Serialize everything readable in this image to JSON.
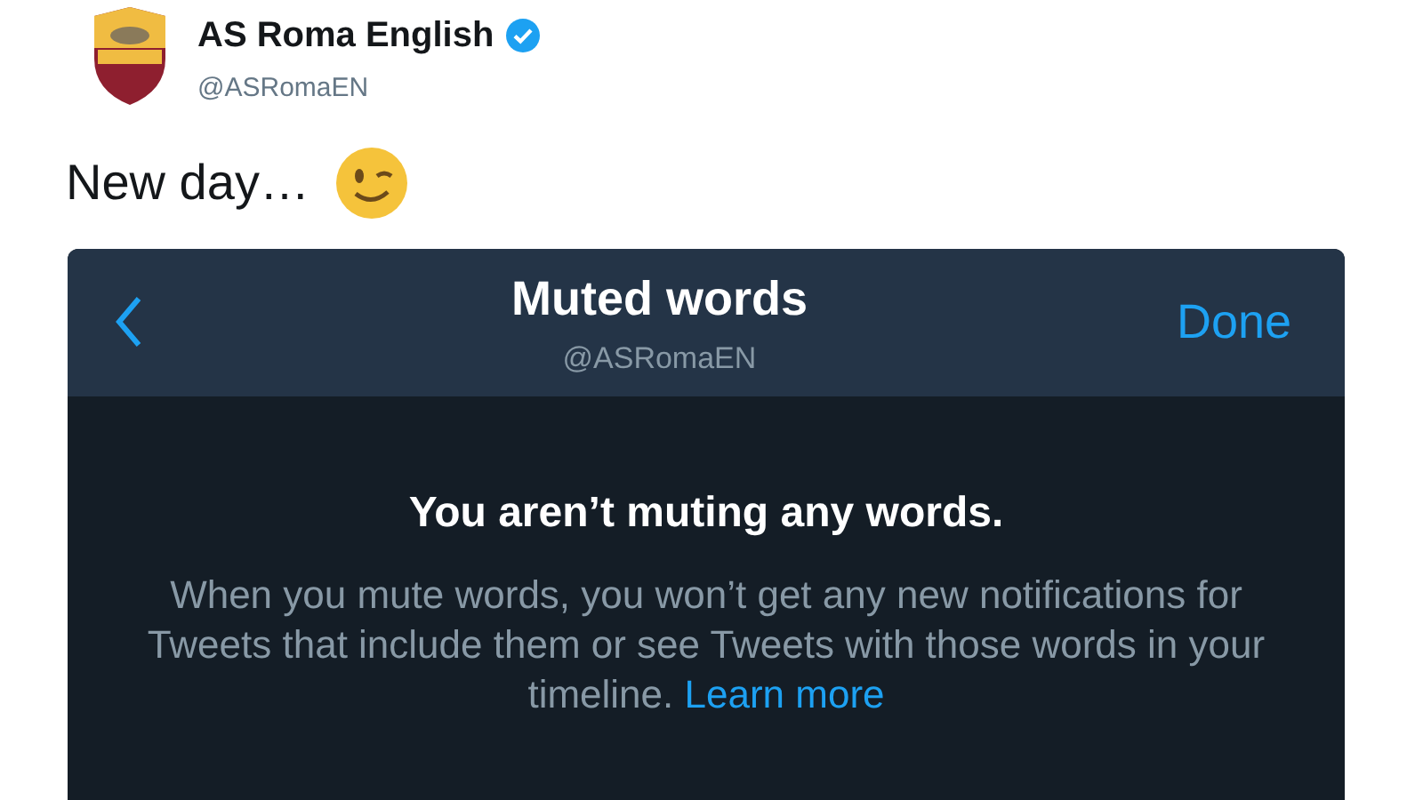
{
  "tweet": {
    "author": "AS Roma English",
    "verified": true,
    "handle": "@ASRomaEN",
    "text": "New day…"
  },
  "screenshot": {
    "title": "Muted words",
    "subtitle": "@ASRomaEN",
    "done": "Done",
    "heading": "You aren’t muting any words.",
    "body": "When you mute words, you won’t get any new notifications for Tweets that include them or see Tweets with those words in your timeline.",
    "link": "Learn more"
  }
}
